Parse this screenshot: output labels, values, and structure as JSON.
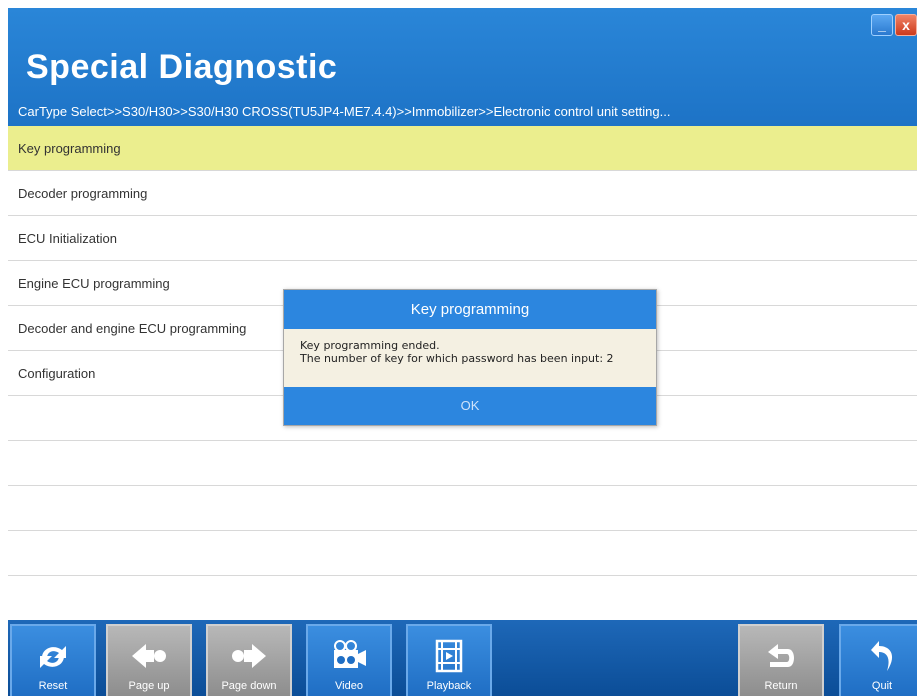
{
  "header": {
    "title": "Special Diagnostic",
    "breadcrumb": "CarType Select>>S30/H30>>S30/H30 CROSS(TU5JP4-ME7.4.4)>>Immobilizer>>Electronic control unit setting..."
  },
  "window_controls": {
    "minimize": "_",
    "close": "x"
  },
  "list": {
    "items": [
      "Key programming",
      "Decoder programming",
      "ECU Initialization",
      "Engine ECU programming",
      "Decoder and engine ECU programming",
      "Configuration",
      "",
      "",
      "",
      "",
      ""
    ],
    "selected_index": 0
  },
  "dialog": {
    "title": "Key programming",
    "line1": "Key programming ended.",
    "line2": "The number of key for which password has been input: 2",
    "ok_label": "OK"
  },
  "footer": {
    "reset": "Reset",
    "page_up": "Page up",
    "page_down": "Page down",
    "video": "Video",
    "playback": "Playback",
    "return": "Return",
    "quit": "Quit"
  },
  "colors": {
    "header_blue": "#1d73c6",
    "selected_row": "#ebee8e",
    "dialog_blue": "#2c86df",
    "footer_blue": "#0b4d97"
  }
}
